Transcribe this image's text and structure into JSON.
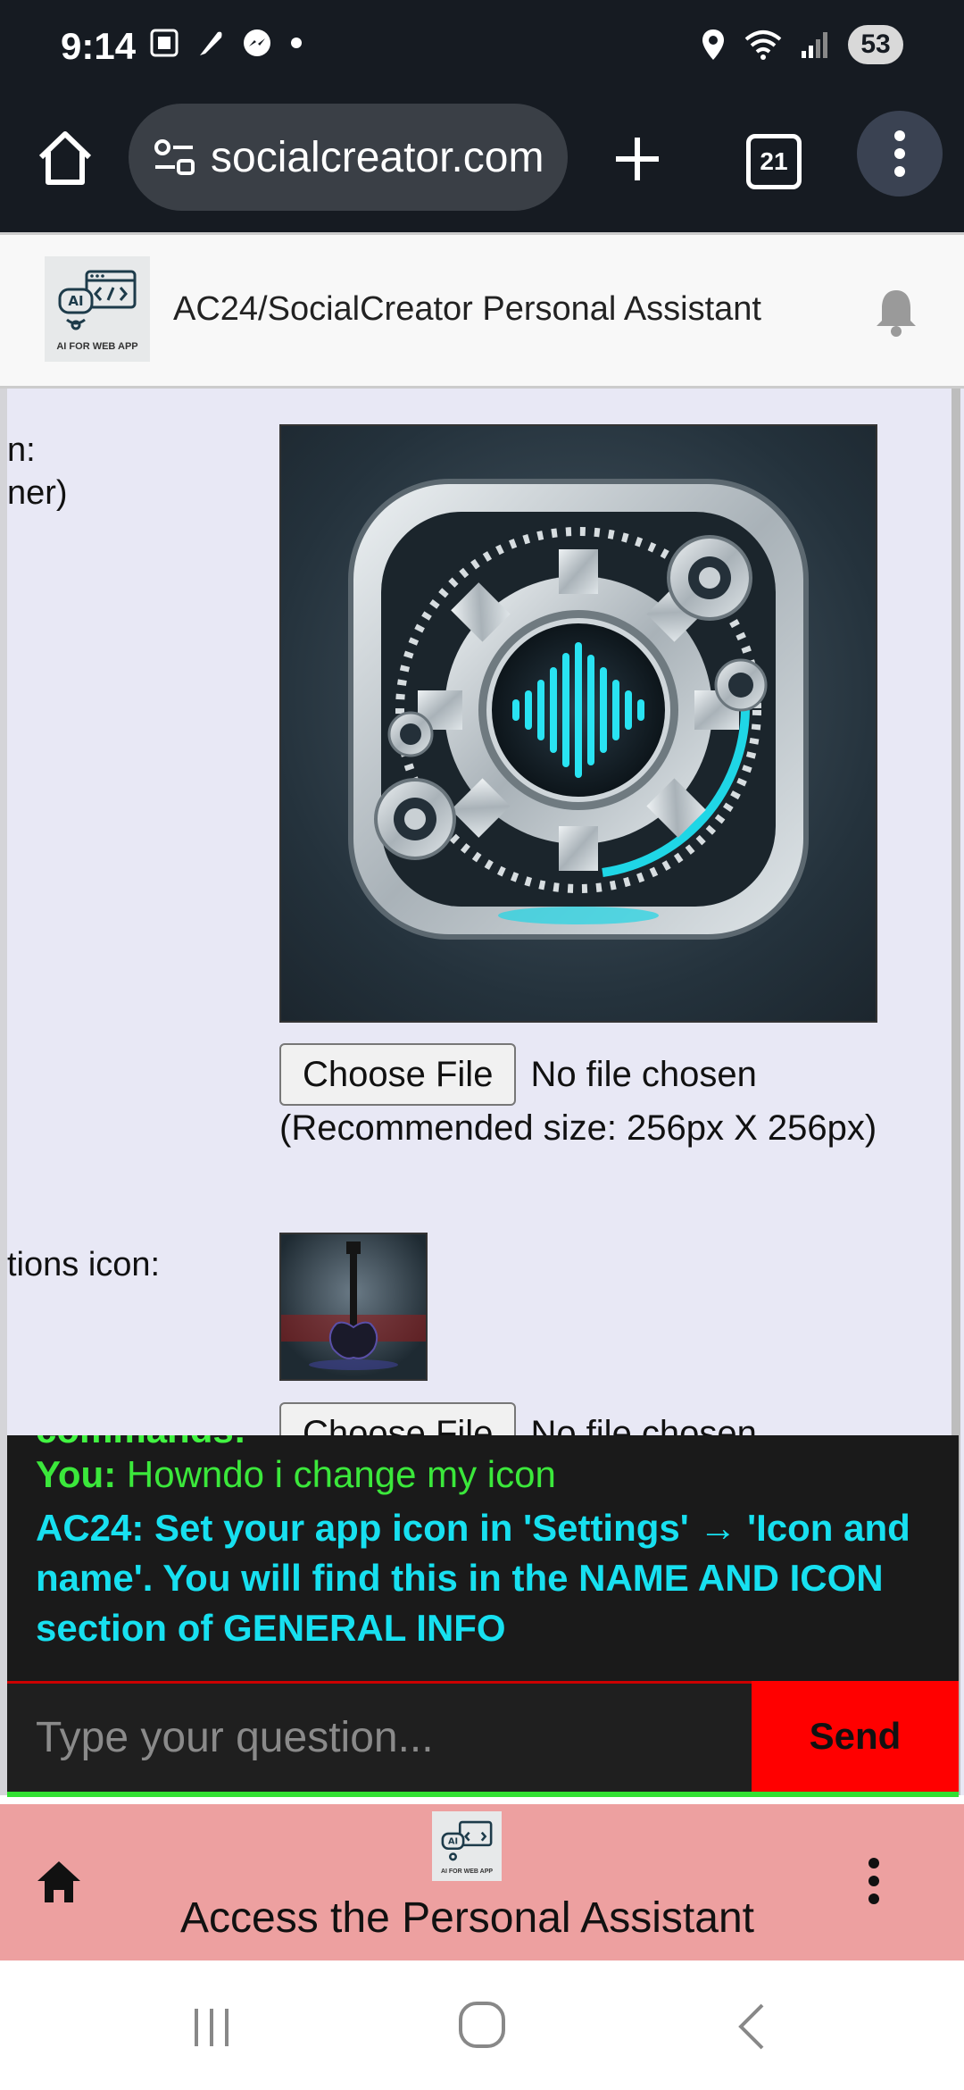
{
  "status_bar": {
    "time": "9:14",
    "battery": "53",
    "icons": [
      "screenshot-icon",
      "feather-icon",
      "messenger-icon",
      "dot-icon",
      "location-icon",
      "wifi-icon",
      "signal-icon",
      "battery-icon"
    ]
  },
  "browser": {
    "url": "socialcreator.com",
    "tab_count": "21"
  },
  "site_header": {
    "logo_caption": "AI FOR WEB APP",
    "title": "AC24/SocialCreator Personal Assistant"
  },
  "content": {
    "label_partial_1_line1": "n:",
    "label_partial_1_line2": "ner)",
    "choose_file_label": "Choose File",
    "file_status": "No file chosen",
    "recommended_size": "(Recommended size: 256px X 256px)",
    "label_partial_2": "tions icon:",
    "choose_file_label_2": "Choose File",
    "file_status_2": "No file chosen"
  },
  "chat": {
    "cut_text": "commands:",
    "user_prefix": "You:",
    "user_message": "Howndo i change my icon",
    "bot_prefix": "AC24:",
    "bot_message": "Set your app icon in 'Settings' → 'Icon and name'. You will find this in the NAME AND ICON section of GENERAL INFO",
    "input_placeholder": "Type your question...",
    "send_label": "Send"
  },
  "bottom_banner": {
    "logo_caption": "AI FOR WEB APP",
    "text": "Access the Personal Assistant"
  },
  "colors": {
    "status_bg": "#161b22",
    "content_bg": "#e8e8f5",
    "chat_bg": "#1a1a1a",
    "user_text": "#3be83b",
    "bot_text": "#17e0f0",
    "send_bg": "#ff0000",
    "banner_bg": "#eda0a0"
  }
}
